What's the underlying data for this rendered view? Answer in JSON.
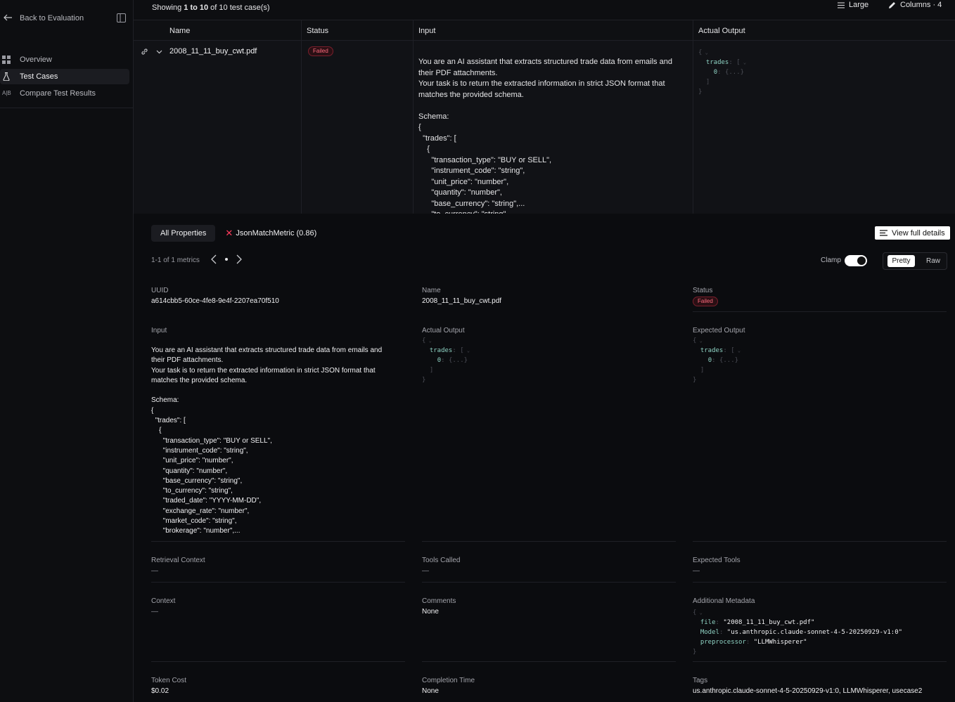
{
  "sidebar": {
    "back_label": "Back to Evaluation",
    "items": [
      {
        "label": "Overview",
        "icon": "grid-icon"
      },
      {
        "label": "Test Cases",
        "icon": "flask-icon"
      },
      {
        "label": "Compare Test Results",
        "icon": "ab-icon",
        "icon_text": "A|B"
      }
    ],
    "active_item": "Test Cases"
  },
  "topbar": {
    "showing_prefix": "Showing ",
    "showing_range": "1 to 10",
    "showing_suffix": " of 10 test case(s)",
    "size_label": "Large",
    "columns_label": "Columns · 4"
  },
  "table": {
    "headers": [
      "Name",
      "Status",
      "Input",
      "Actual Output"
    ],
    "row": {
      "name": "2008_11_11_buy_cwt.pdf",
      "status": "Failed",
      "input": "You are an AI assistant that extracts structured trade data from emails and their PDF attachments.\nYour task is to return the extracted information in strict JSON format that matches the provided schema.\n\nSchema:\n{\n  \"trades\": [\n    {\n      \"transaction_type\": \"BUY or SELL\",\n      \"instrument_code\": \"string\",\n      \"unit_price\": \"number\",\n      \"quantity\": \"number\",\n      \"base_currency\": \"string\",...\n      \"to_currency\": \"string\",",
      "output_key": "trades",
      "output_index": "0",
      "output_collapsed": "{...}"
    }
  },
  "detail": {
    "tab_all": "All Properties",
    "tab_metric": "JsonMatchMetric (0.86)",
    "view_full": "View full details",
    "pager": "1-1 of 1 metrics",
    "clamp_label": "Clamp",
    "clamp_on": true,
    "seg_pretty": "Pretty",
    "seg_raw": "Raw",
    "uuid_label": "UUID",
    "uuid_value": "a614cbb5-60ce-4fe8-9e4f-2207ea70f510",
    "name_label": "Name",
    "name_value": "2008_11_11_buy_cwt.pdf",
    "status_label": "Status",
    "status_value": "Failed",
    "input_label": "Input",
    "input_value": "You are an AI assistant that extracts structured trade data from emails and their PDF attachments.\nYour task is to return the extracted information in strict JSON format that matches the provided schema.\n\nSchema:\n{\n  \"trades\": [\n    {\n      \"transaction_type\": \"BUY or SELL\",\n      \"instrument_code\": \"string\",\n      \"unit_price\": \"number\",\n      \"quantity\": \"number\",\n      \"base_currency\": \"string\",\n      \"to_currency\": \"string\",\n      \"traded_date\": \"YYYY-MM-DD\",\n      \"exchange_rate\": \"number\",\n      \"market_code\": \"string\",\n      \"brokerage\": \"number\",...",
    "actual_label": "Actual Output",
    "expected_label": "Expected Output",
    "json_key": "trades",
    "json_index": "0",
    "json_collapsed": "{...}",
    "retrieval_label": "Retrieval Context",
    "retrieval_value": "—",
    "tools_label": "Tools Called",
    "tools_value": "—",
    "expected_tools_label": "Expected Tools",
    "expected_tools_value": "—",
    "context_label": "Context",
    "context_value": "—",
    "comments_label": "Comments",
    "comments_value": "None",
    "metadata_label": "Additional Metadata",
    "metadata": [
      {
        "key": "file",
        "value": "\"2008_11_11_buy_cwt.pdf\""
      },
      {
        "key": "Model",
        "value": "\"us.anthropic.claude-sonnet-4-5-20250929-v1:0\""
      },
      {
        "key": "preprocessor",
        "value": "\"LLMWhisperer\""
      }
    ],
    "token_label": "Token Cost",
    "token_value": "$0.02",
    "completion_label": "Completion Time",
    "completion_value": "None",
    "tags_label": "Tags",
    "tags_value": "us.anthropic.claude-sonnet-4-5-20250929-v1:0, LLMWhisperer, usecase2"
  },
  "colors": {
    "background": "#0b0c0f",
    "failed_badge": "#ff6b7d",
    "json_key": "#8fd3c4",
    "metric_fail": "#ff3b5c"
  }
}
